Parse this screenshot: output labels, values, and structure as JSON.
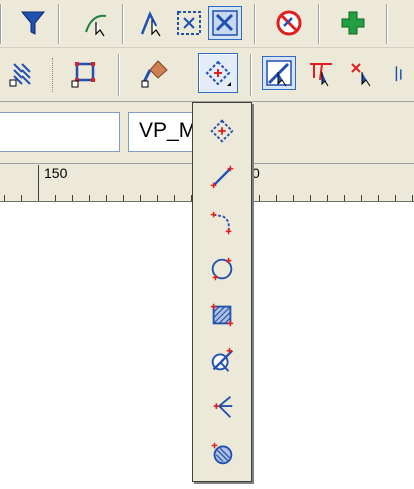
{
  "window": {
    "name_field_value": "",
    "layer_field_value": "VP_M"
  },
  "toolbar_top": {
    "items": [
      {
        "name": "filter-icon"
      },
      {
        "name": "select-curve-icon"
      },
      {
        "name": "select-arrow-icon"
      },
      {
        "name": "grid-select-icon"
      },
      {
        "name": "select-box-icon"
      },
      {
        "name": "no-entry-icon"
      },
      {
        "name": "add-plus-icon"
      }
    ]
  },
  "toolbar_second": {
    "items": [
      {
        "name": "hatch-pattern-icon"
      },
      {
        "name": "frame-select-icon"
      },
      {
        "name": "paint-brush-icon"
      },
      {
        "name": "snap-point-icon",
        "active": true
      },
      {
        "name": "pick-line-icon",
        "pressed": true
      },
      {
        "name": "multi-arrow-icon"
      },
      {
        "name": "cross-arrow-icon"
      }
    ]
  },
  "ruler": {
    "label_150": "150",
    "label_right": "0"
  },
  "flyout": {
    "items": [
      {
        "name": "snap-point-icon"
      },
      {
        "name": "snap-line-icon"
      },
      {
        "name": "snap-polyline-icon"
      },
      {
        "name": "snap-circle-icon"
      },
      {
        "name": "snap-area-icon"
      },
      {
        "name": "snap-intersection-icon"
      },
      {
        "name": "snap-branch-icon"
      },
      {
        "name": "snap-sphere-icon"
      }
    ]
  },
  "colors": {
    "accent": "#316ac5",
    "toolbar_bg": "#ece9d8",
    "icon_blue": "#2050b0",
    "icon_red": "#e02020"
  }
}
